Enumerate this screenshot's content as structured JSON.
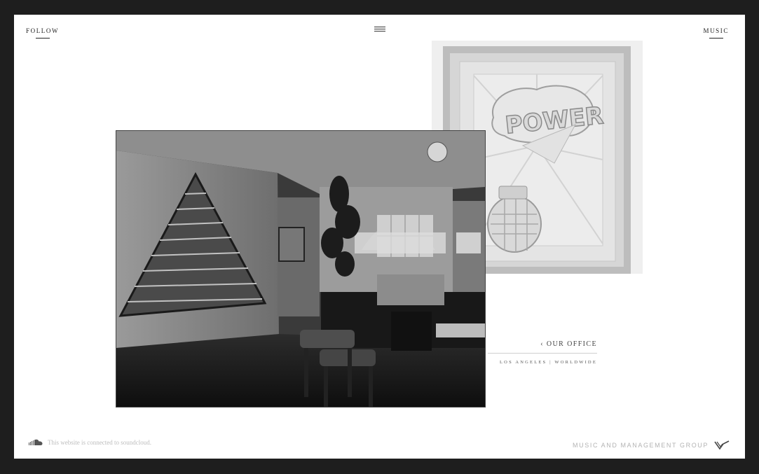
{
  "header": {
    "follow_label": "FOLLOW",
    "music_label": "MUSIC",
    "menu_icon": "hamburger-icon"
  },
  "gallery": {
    "back_photo_icon": "power-artwork-photo",
    "front_photo_icon": "office-interior-photo",
    "power_text": "POWER"
  },
  "caption": {
    "title": "‹ OUR OFFICE",
    "location": "LOS ANGELES | WORLDWIDE"
  },
  "footer": {
    "soundcloud_icon": "soundcloud-icon",
    "soundcloud_note": "This website is connected to soundcloud.",
    "brand_name": "MUSIC AND MANAGEMENT GROUP",
    "logo_icon": "brand-logo-icon"
  },
  "colors": {
    "outer_border": "#1e1e1e",
    "page_background": "#ffffff",
    "text_dark": "#222222",
    "text_muted": "#b3b3b3"
  }
}
